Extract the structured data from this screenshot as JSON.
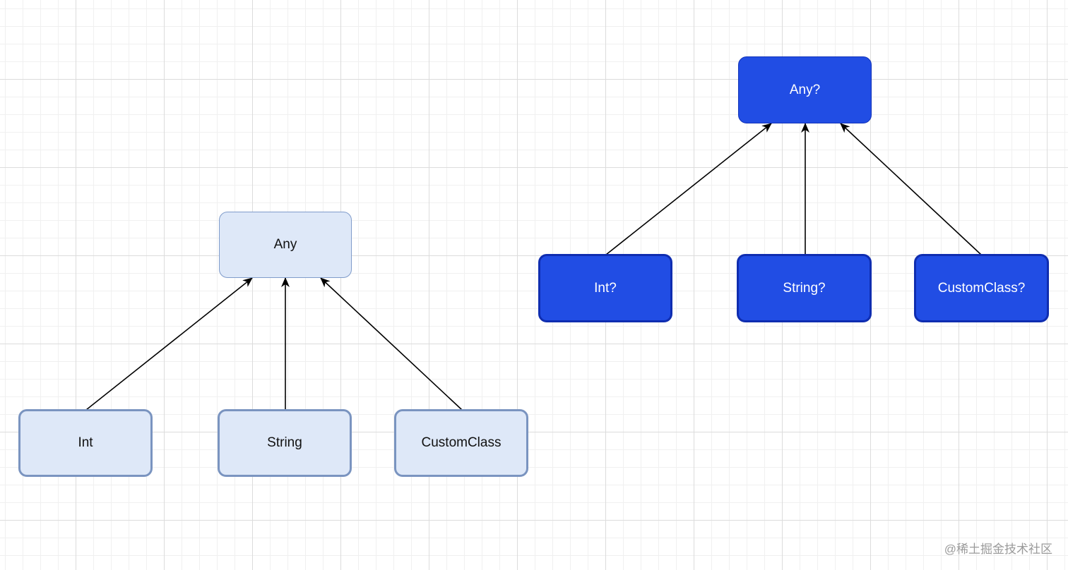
{
  "left_tree": {
    "root": "Any",
    "children": [
      "Int",
      "String",
      "CustomClass"
    ]
  },
  "right_tree": {
    "root": "Any?",
    "children": [
      "Int?",
      "String?",
      "CustomClass?"
    ]
  },
  "colors": {
    "light_fill": "#dee8f8",
    "light_border": "#7a94c0",
    "dark_fill": "#214de4",
    "dark_border": "#0f2db0",
    "edge": "#000000"
  },
  "watermark": "@稀土掘金技术社区"
}
